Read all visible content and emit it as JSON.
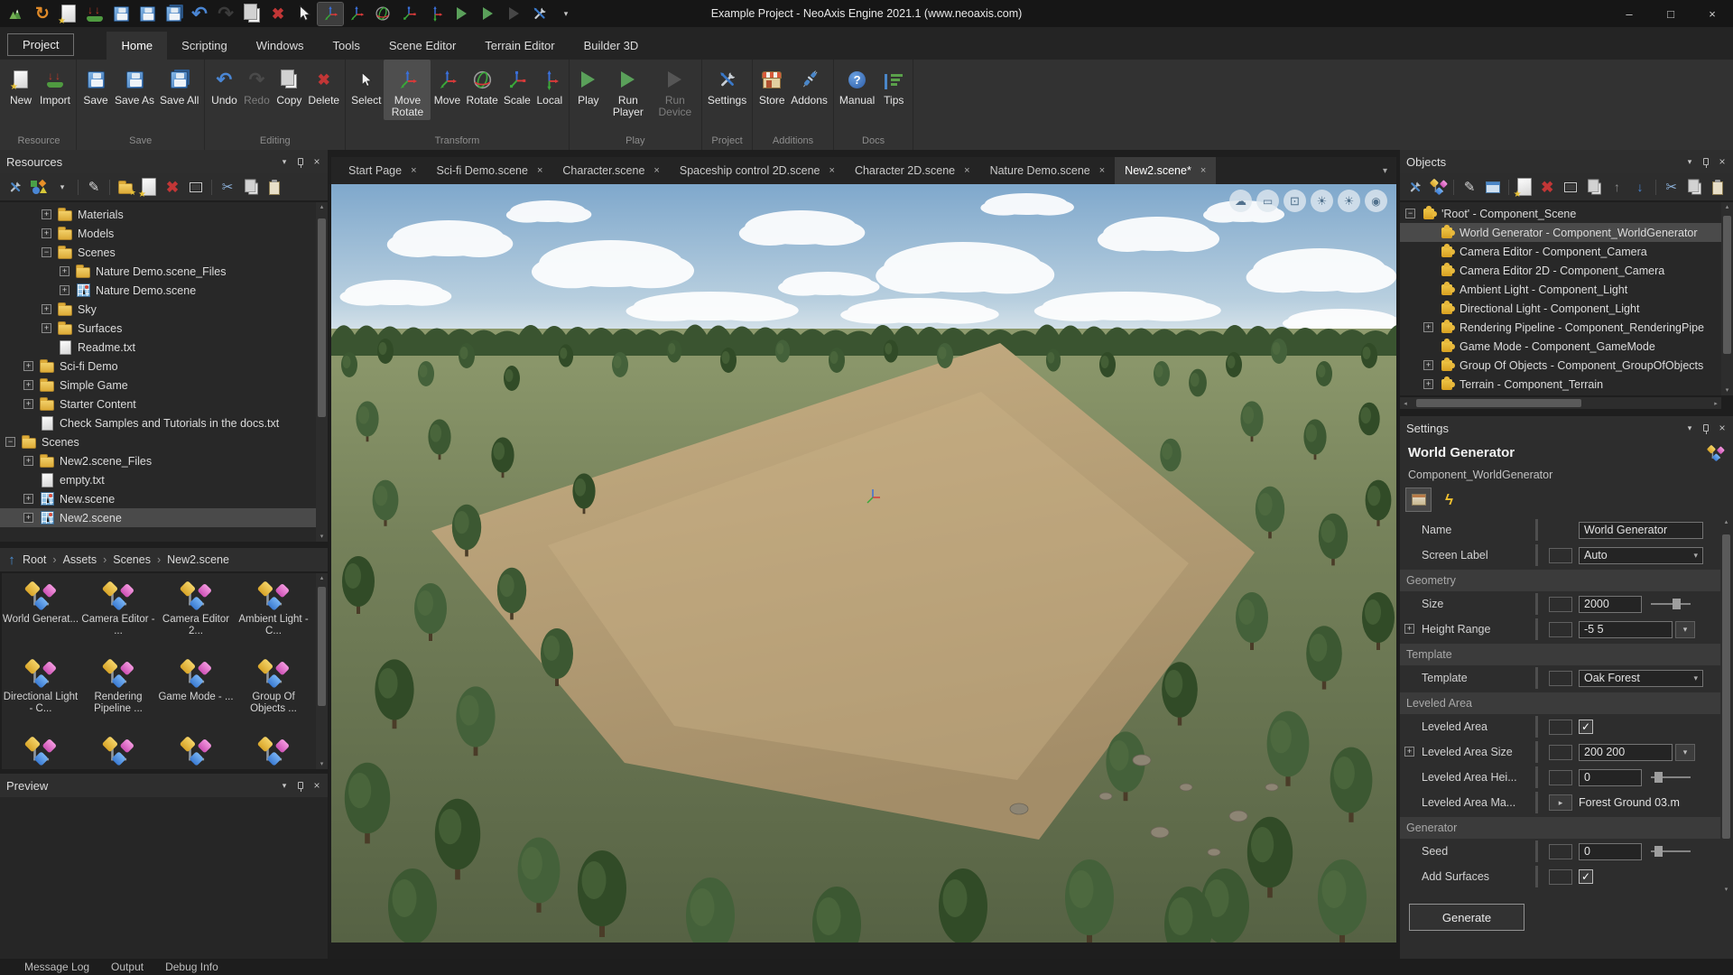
{
  "title_bar": {
    "title": "Example Project - NeoAxis Engine 2021.1 (www.neoaxis.com)",
    "quick_access": [
      {
        "name": "app-logo",
        "icon": "logo"
      },
      {
        "name": "refresh",
        "icon": "sync"
      },
      {
        "name": "new",
        "icon": "file-star"
      },
      {
        "name": "import",
        "icon": "import"
      },
      {
        "name": "save",
        "icon": "floppy"
      },
      {
        "name": "save-as",
        "icon": "floppy"
      },
      {
        "name": "save-all",
        "icon": "floppy-all"
      },
      {
        "name": "undo",
        "icon": "undo"
      },
      {
        "name": "redo",
        "icon": "redo",
        "disabled": true
      },
      {
        "name": "copy",
        "icon": "copy"
      },
      {
        "name": "delete",
        "icon": "delete"
      },
      {
        "name": "select",
        "icon": "cursor"
      },
      {
        "name": "move-rotate",
        "icon": "axes",
        "active": true
      },
      {
        "name": "move",
        "icon": "axes"
      },
      {
        "name": "rotate",
        "icon": "rotate"
      },
      {
        "name": "scale",
        "icon": "axes-scale"
      },
      {
        "name": "local",
        "icon": "axes-local"
      },
      {
        "name": "play",
        "icon": "play"
      },
      {
        "name": "run-player",
        "icon": "play"
      },
      {
        "name": "run-device",
        "icon": "play",
        "disabled": true
      },
      {
        "name": "settings-tools",
        "icon": "wrenchx"
      },
      {
        "name": "customize",
        "icon": "caret"
      }
    ],
    "window_controls": [
      {
        "name": "minimize",
        "glyph": "–"
      },
      {
        "name": "maximize",
        "glyph": "□"
      },
      {
        "name": "close",
        "glyph": "×"
      }
    ]
  },
  "ribbon": {
    "project_tab": "Project",
    "tabs": [
      {
        "label": "Home",
        "active": true
      },
      {
        "label": "Scripting"
      },
      {
        "label": "Windows"
      },
      {
        "label": "Tools"
      },
      {
        "label": "Scene Editor"
      },
      {
        "label": "Terrain Editor"
      },
      {
        "label": "Builder 3D"
      }
    ],
    "groups": [
      {
        "label": "Resource",
        "buttons": [
          {
            "label": "New",
            "icon": "file-star"
          },
          {
            "label": "Import",
            "icon": "import"
          }
        ]
      },
      {
        "label": "Save",
        "buttons": [
          {
            "label": "Save",
            "icon": "floppy"
          },
          {
            "label": "Save As",
            "icon": "floppy"
          },
          {
            "label": "Save All",
            "icon": "floppy-all"
          }
        ]
      },
      {
        "label": "Editing",
        "buttons": [
          {
            "label": "Undo",
            "icon": "undo"
          },
          {
            "label": "Redo",
            "icon": "redo",
            "disabled": true
          },
          {
            "label": "Copy",
            "icon": "copy"
          },
          {
            "label": "Delete",
            "icon": "delete"
          }
        ]
      },
      {
        "label": "Transform",
        "buttons": [
          {
            "label": "Select",
            "icon": "cursor"
          },
          {
            "label": "Move Rotate",
            "icon": "axes",
            "active": true
          },
          {
            "label": "Move",
            "icon": "axes"
          },
          {
            "label": "Rotate",
            "icon": "rotate"
          },
          {
            "label": "Scale",
            "icon": "axes-scale"
          },
          {
            "label": "Local",
            "icon": "axes-local"
          }
        ]
      },
      {
        "label": "Play",
        "buttons": [
          {
            "label": "Play",
            "icon": "play"
          },
          {
            "label": "Run Player",
            "icon": "play"
          },
          {
            "label": "Run Device",
            "icon": "play",
            "disabled": true
          }
        ]
      },
      {
        "label": "Project",
        "buttons": [
          {
            "label": "Settings",
            "icon": "wrenchx"
          }
        ]
      },
      {
        "label": "Additions",
        "buttons": [
          {
            "label": "Store",
            "icon": "store"
          },
          {
            "label": "Addons",
            "icon": "plug"
          }
        ]
      },
      {
        "label": "Docs",
        "buttons": [
          {
            "label": "Manual",
            "icon": "question"
          },
          {
            "label": "Tips",
            "icon": "tips"
          }
        ]
      }
    ]
  },
  "resources_panel": {
    "title": "Resources",
    "toolbar": [
      "wrench",
      "shapes",
      "caret",
      "sep",
      "edit",
      "sep",
      "new-folder",
      "file-star",
      "delete",
      "frame",
      "sep",
      "cut",
      "copy2",
      "paste"
    ],
    "tree": [
      {
        "label": "Materials",
        "icon": "folder",
        "level": 2,
        "exp": "+"
      },
      {
        "label": "Models",
        "icon": "folder",
        "level": 2,
        "exp": "+"
      },
      {
        "label": "Scenes",
        "icon": "folder",
        "level": 2,
        "exp": "-"
      },
      {
        "label": "Nature Demo.scene_Files",
        "icon": "folder",
        "level": 3,
        "exp": "+"
      },
      {
        "label": "Nature Demo.scene",
        "icon": "scene",
        "level": 3,
        "exp": "+"
      },
      {
        "label": "Sky",
        "icon": "folder",
        "level": 2,
        "exp": "+"
      },
      {
        "label": "Surfaces",
        "icon": "folder",
        "level": 2,
        "exp": "+"
      },
      {
        "label": "Readme.txt",
        "icon": "file",
        "level": 2
      },
      {
        "label": "Sci-fi Demo",
        "icon": "folder",
        "level": 1,
        "exp": "+"
      },
      {
        "label": "Simple Game",
        "icon": "folder",
        "level": 1,
        "exp": "+"
      },
      {
        "label": "Starter Content",
        "icon": "folder",
        "level": 1,
        "exp": "+"
      },
      {
        "label": "Check Samples and Tutorials in the docs.txt",
        "icon": "file",
        "level": 1
      },
      {
        "label": "Scenes",
        "icon": "folder",
        "level": 0,
        "exp": "-"
      },
      {
        "label": "New2.scene_Files",
        "icon": "folder",
        "level": 1,
        "exp": "+"
      },
      {
        "label": "empty.txt",
        "icon": "file",
        "level": 1
      },
      {
        "label": "New.scene",
        "icon": "scene",
        "level": 1,
        "exp": "+"
      },
      {
        "label": "New2.scene",
        "icon": "scene",
        "level": 1,
        "exp": "+",
        "selected": true
      }
    ],
    "breadcrumb": [
      "Root",
      "Assets",
      "Scenes",
      "New2.scene"
    ],
    "assets": [
      "World Generat...",
      "Camera Editor - ...",
      "Camera Editor 2...",
      "Ambient Light - C...",
      "Directional Light - C...",
      "Rendering Pipeline ...",
      "Game Mode - ...",
      "Group Of Objects ..."
    ],
    "assets_partial_count": 4
  },
  "preview_panel": {
    "title": "Preview"
  },
  "viewport": {
    "tabs": [
      {
        "label": "Start Page"
      },
      {
        "label": "Sci-fi Demo.scene"
      },
      {
        "label": "Character.scene"
      },
      {
        "label": "Spaceship control 2D.scene"
      },
      {
        "label": "Character 2D.scene"
      },
      {
        "label": "Nature Demo.scene"
      },
      {
        "label": "New2.scene*",
        "active": true
      }
    ],
    "overlay_buttons": [
      {
        "name": "cloud-button",
        "icon": "cloud"
      },
      {
        "name": "frame-button",
        "icon": "frame2"
      },
      {
        "name": "display-button",
        "icon": "display"
      },
      {
        "name": "brightness-button",
        "icon": "sun"
      },
      {
        "name": "brightness2-button",
        "icon": "sun"
      },
      {
        "name": "camera-button",
        "icon": "camera"
      }
    ]
  },
  "objects_panel": {
    "title": "Objects",
    "toolbar": [
      "wrench",
      "comp-small",
      "sep",
      "edit",
      "window",
      "sep",
      "file-star",
      "delete",
      "frame",
      "dup",
      "up",
      "down",
      "sep",
      "cut",
      "copy2",
      "paste"
    ],
    "tree": [
      {
        "label": "'Root' - Component_Scene",
        "icon": "puzzle",
        "level": 0,
        "exp": "-"
      },
      {
        "label": "World Generator - Component_WorldGenerator",
        "icon": "puzzle",
        "level": 1,
        "selected": true
      },
      {
        "label": "Camera Editor - Component_Camera",
        "icon": "puzzle",
        "level": 1
      },
      {
        "label": "Camera Editor 2D - Component_Camera",
        "icon": "puzzle",
        "level": 1
      },
      {
        "label": "Ambient Light - Component_Light",
        "icon": "puzzle",
        "level": 1
      },
      {
        "label": "Directional Light - Component_Light",
        "icon": "puzzle",
        "level": 1
      },
      {
        "label": "Rendering Pipeline - Component_RenderingPipe",
        "icon": "puzzle",
        "level": 1,
        "exp": "+"
      },
      {
        "label": "Game Mode - Component_GameMode",
        "icon": "puzzle",
        "level": 1
      },
      {
        "label": "Group Of Objects - Component_GroupOfObjects",
        "icon": "puzzle",
        "level": 1,
        "exp": "+"
      },
      {
        "label": "Terrain - Component_Terrain",
        "icon": "puzzle",
        "level": 1,
        "exp": "+"
      }
    ]
  },
  "settings_panel": {
    "title": "Settings",
    "object_name": "World Generator",
    "object_type": "Component_WorldGenerator",
    "tabs": [
      {
        "name": "properties-tab",
        "icon": "props",
        "active": true
      },
      {
        "name": "events-tab",
        "icon": "lightning"
      }
    ],
    "properties": [
      {
        "label": "Name",
        "kind": "text",
        "value": "World Generator"
      },
      {
        "label": "Screen Label",
        "kind": "combo",
        "value": "Auto"
      },
      {
        "label": "Geometry",
        "kind": "category"
      },
      {
        "label": "Size",
        "kind": "slider",
        "value": "2000",
        "pos": 55
      },
      {
        "label": "Height Range",
        "kind": "combo-split",
        "value": "-5 5",
        "exp": true
      },
      {
        "label": "Template",
        "kind": "category"
      },
      {
        "label": "Template",
        "kind": "combo",
        "value": "Oak Forest"
      },
      {
        "label": "Leveled Area",
        "kind": "category"
      },
      {
        "label": "Leveled Area",
        "kind": "check",
        "checked": true
      },
      {
        "label": "Leveled Area Size",
        "kind": "combo-split",
        "value": "200 200",
        "exp": true
      },
      {
        "label": "Leveled Area Hei...",
        "kind": "slider",
        "value": "0",
        "pos": 8
      },
      {
        "label": "Leveled Area Ma...",
        "kind": "ref",
        "value": "Forest Ground 03.m"
      },
      {
        "label": "Generator",
        "kind": "category"
      },
      {
        "label": "Seed",
        "kind": "slider",
        "value": "0",
        "pos": 8
      },
      {
        "label": "Add Surfaces",
        "kind": "check",
        "checked": true
      }
    ],
    "generate_label": "Generate"
  },
  "status_bar": {
    "items": [
      "Message Log",
      "Output",
      "Debug Info"
    ]
  }
}
